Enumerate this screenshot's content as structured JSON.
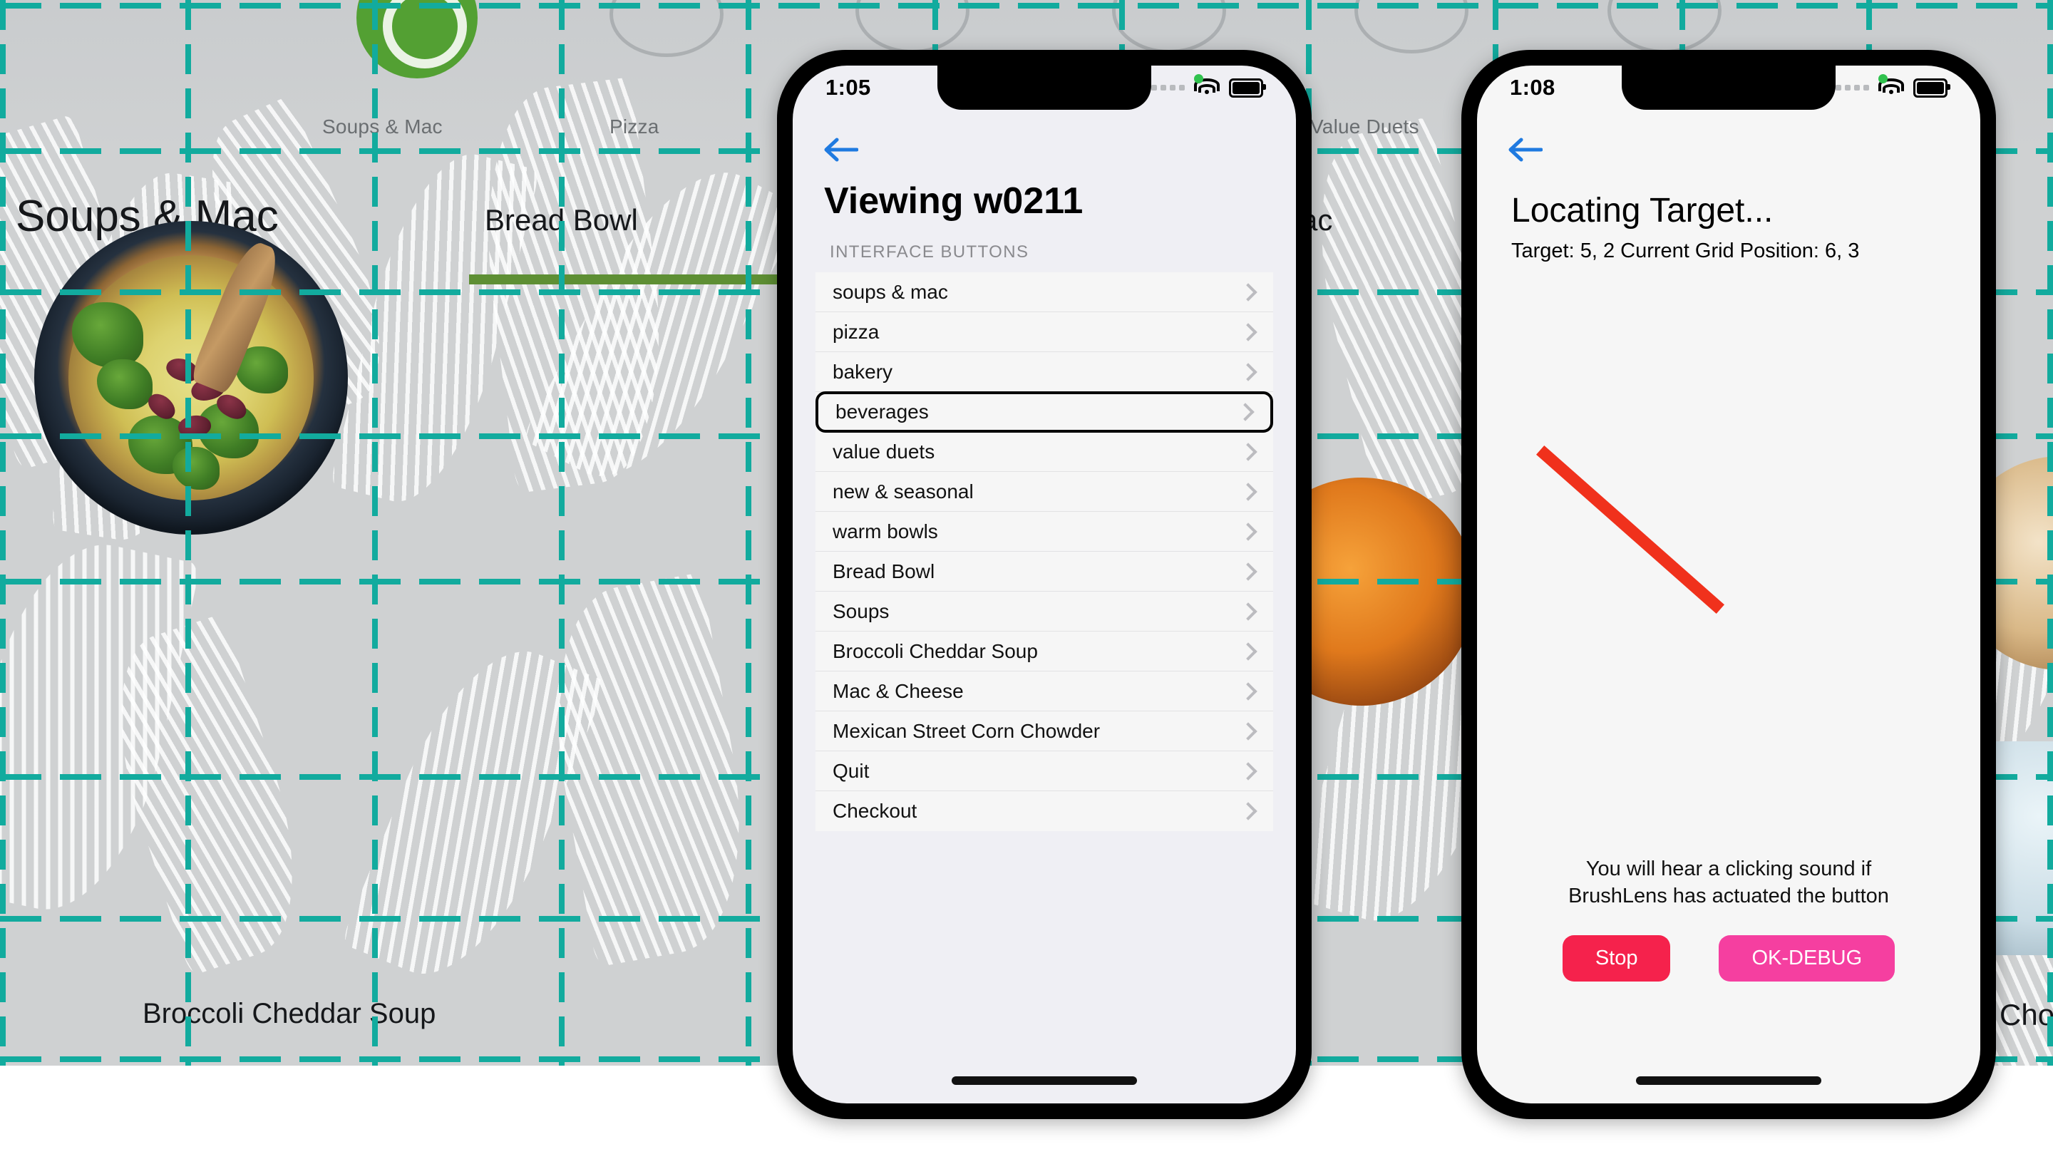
{
  "background_app": {
    "name": "panera-menu-screen",
    "category_labels": [
      "Soups & Mac",
      "Pizza",
      "Value Duets"
    ],
    "headline_labels": [
      "Soups & Mac",
      "Bread Bowl",
      "Mac",
      "Cho"
    ],
    "item_caption": "Broccoli Cheddar Soup",
    "grid_color": "#12ab9e"
  },
  "phone_middle": {
    "status": {
      "time": "1:05",
      "wifi_icon": "wifi-icon",
      "battery_icon": "battery-icon",
      "recording_dot": "green-recording-dot"
    },
    "back_icon": "back-arrow-icon",
    "title": "Viewing w0211",
    "section_header": "INTERFACE BUTTONS",
    "list_items": [
      {
        "label": "soups & mac",
        "selected": false
      },
      {
        "label": "pizza",
        "selected": false
      },
      {
        "label": "bakery",
        "selected": false
      },
      {
        "label": "beverages",
        "selected": true
      },
      {
        "label": "value duets",
        "selected": false
      },
      {
        "label": "new & seasonal",
        "selected": false
      },
      {
        "label": "warm bowls",
        "selected": false
      },
      {
        "label": "Bread Bowl",
        "selected": false
      },
      {
        "label": "Soups",
        "selected": false
      },
      {
        "label": "Broccoli Cheddar Soup",
        "selected": false
      },
      {
        "label": "Mac & Cheese",
        "selected": false
      },
      {
        "label": "Mexican Street Corn Chowder",
        "selected": false
      },
      {
        "label": "Quit",
        "selected": false
      },
      {
        "label": "Checkout",
        "selected": false
      }
    ],
    "chevron_icon": "chevron-right-icon",
    "home_indicator": "home-indicator"
  },
  "phone_right": {
    "status": {
      "time": "1:08",
      "wifi_icon": "wifi-icon",
      "battery_icon": "battery-icon",
      "recording_dot": "green-recording-dot"
    },
    "back_icon": "back-arrow-icon",
    "title": "Locating Target...",
    "subtitle": "Target: 5, 2  Current Grid Position: 6, 3",
    "target_coords": "5, 2",
    "current_grid_position": "6, 3",
    "direction_arrow": {
      "name": "red-direction-arrow",
      "color": "#f0311c"
    },
    "hint_line1": "You will hear a clicking sound if",
    "hint_line2": "BrushLens has actuated the button",
    "buttons": [
      {
        "label": "Stop",
        "color": "#f5224c"
      },
      {
        "label": "OK-DEBUG",
        "color": "#f53fa0"
      }
    ],
    "home_indicator": "home-indicator"
  }
}
